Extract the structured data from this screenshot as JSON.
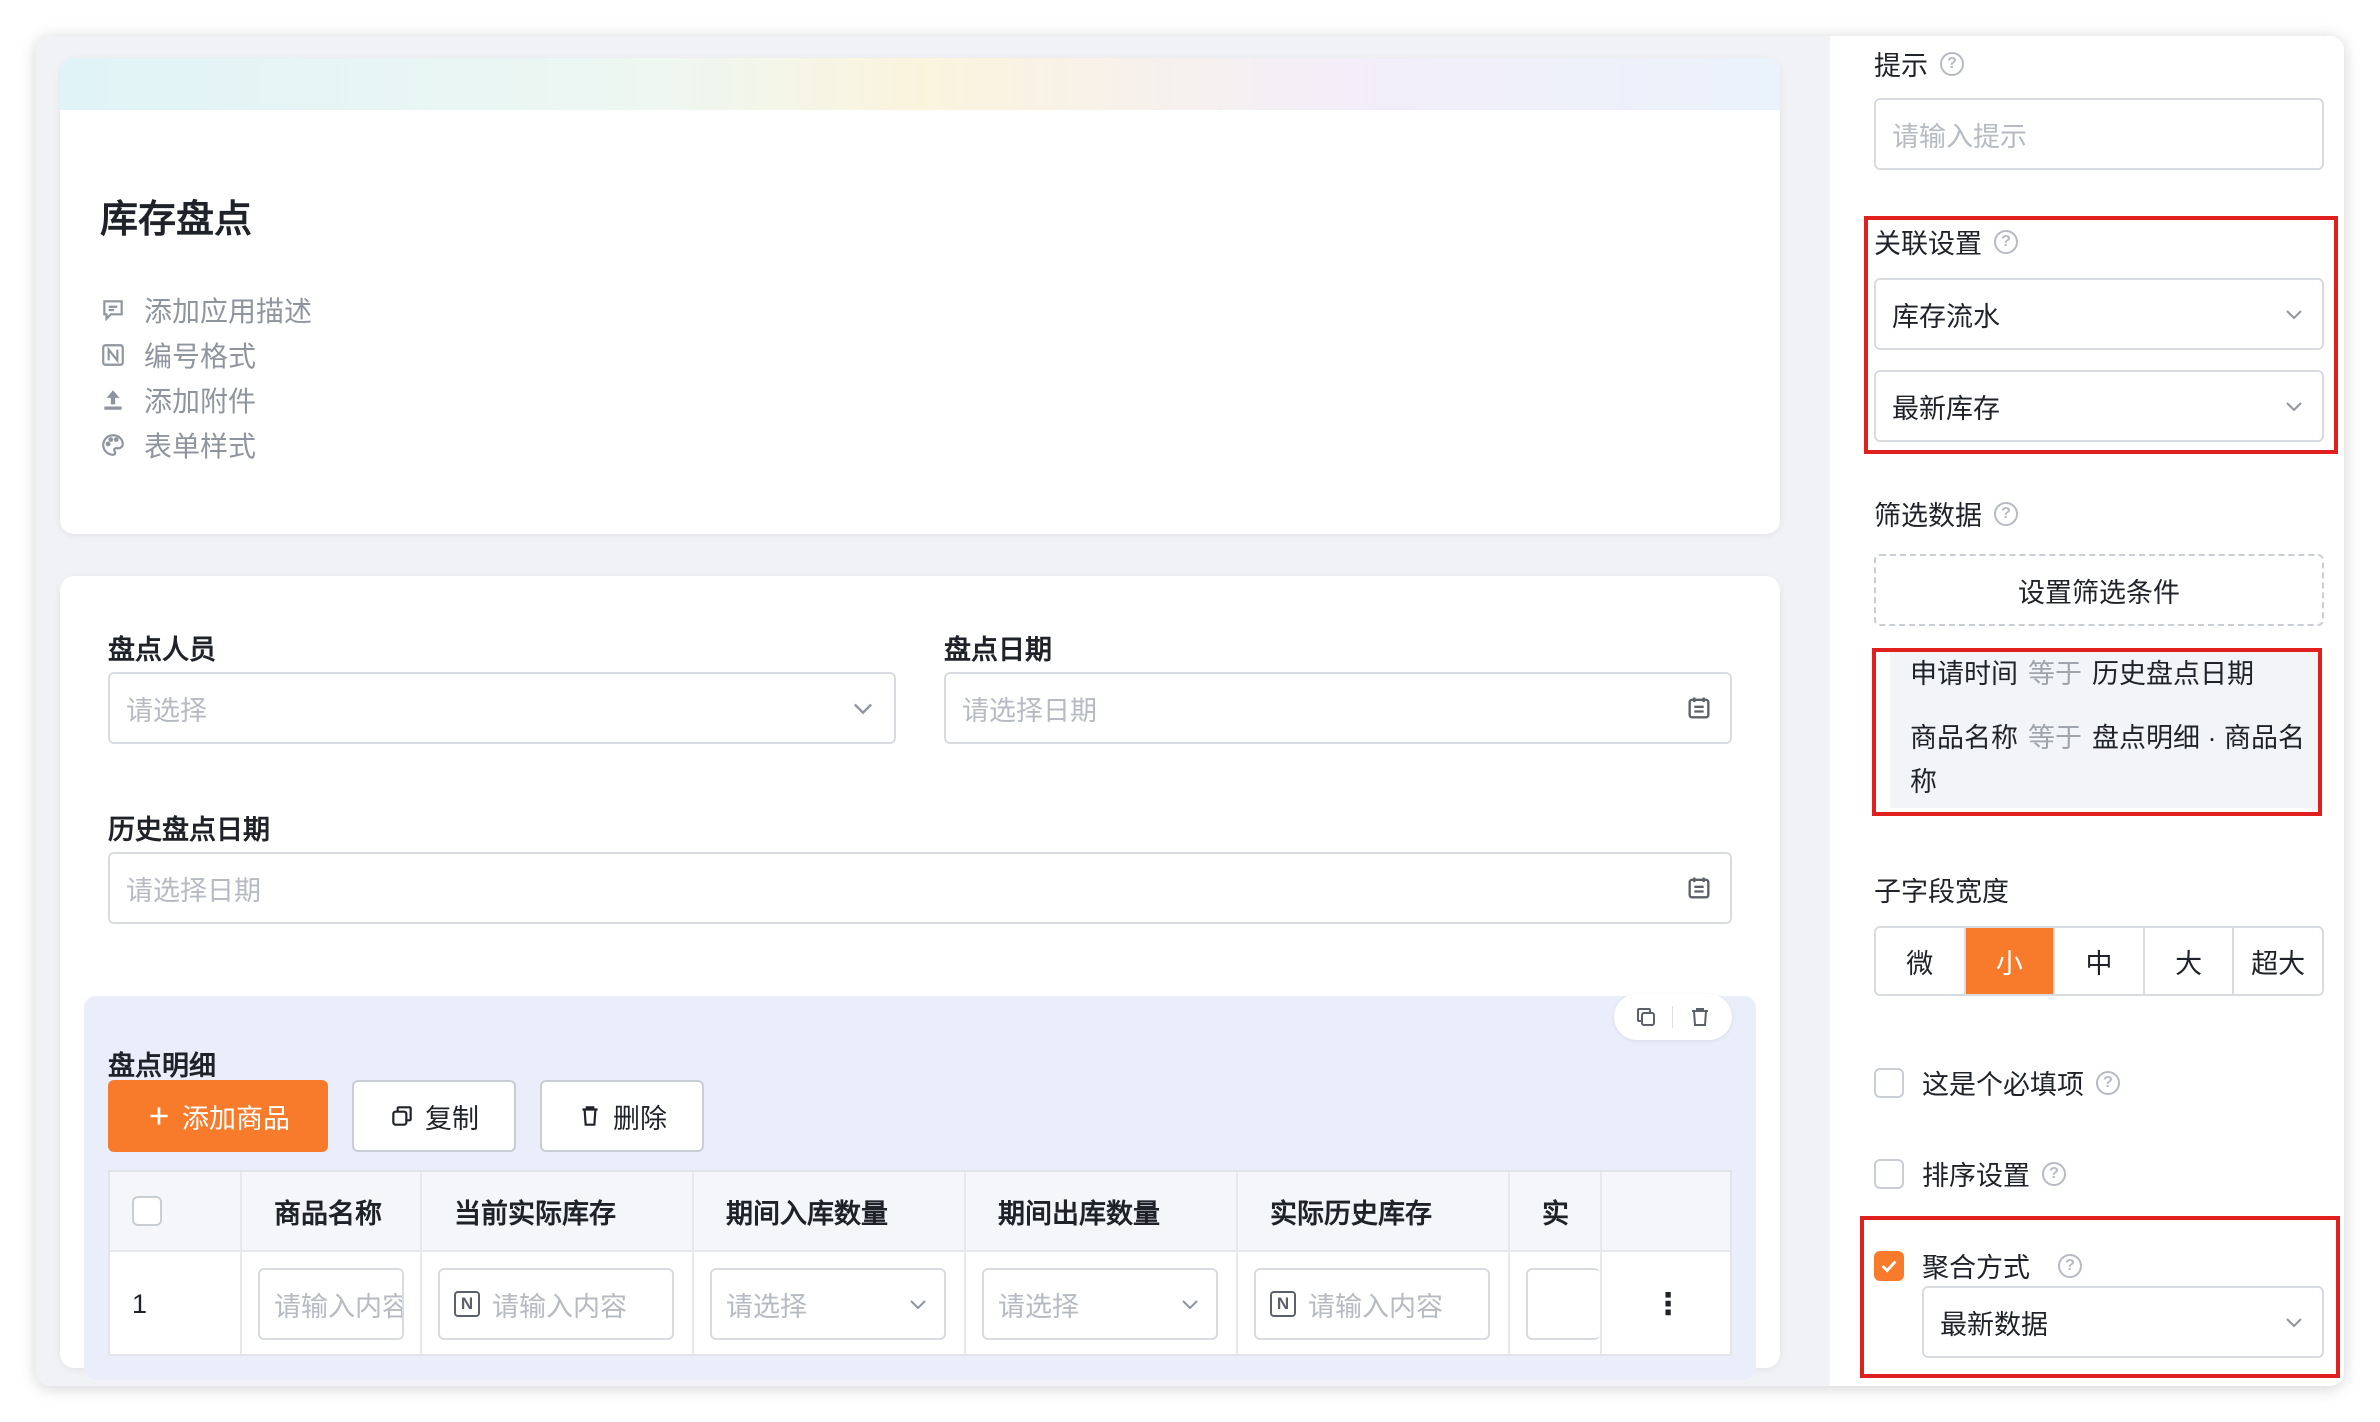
{
  "app": {
    "title": "库存盘点",
    "meta": [
      {
        "icon": "comment-icon",
        "label": "添加应用描述"
      },
      {
        "icon": "number-format-icon",
        "label": "编号格式"
      },
      {
        "icon": "upload-icon",
        "label": "添加附件"
      },
      {
        "icon": "palette-icon",
        "label": "表单样式"
      }
    ]
  },
  "form": {
    "counter_label": "盘点人员",
    "counter_placeholder": "请选择",
    "date_label": "盘点日期",
    "date_placeholder": "请选择日期",
    "history_label": "历史盘点日期",
    "history_placeholder": "请选择日期"
  },
  "subtable": {
    "title": "盘点明细",
    "add_button": "添加商品",
    "copy_button": "复制",
    "delete_button": "删除",
    "columns": [
      "商品名称",
      "当前实际库存",
      "期间入库数量",
      "期间出库数量",
      "实际历史库存",
      "实"
    ],
    "row": {
      "index": "1",
      "cells": [
        {
          "type": "text",
          "placeholder": "请输入内容"
        },
        {
          "type": "number",
          "placeholder": "请输入内容"
        },
        {
          "type": "select",
          "placeholder": "请选择"
        },
        {
          "type": "select",
          "placeholder": "请选择"
        },
        {
          "type": "number",
          "placeholder": "请输入内容"
        }
      ]
    },
    "more_glyph": "⋮"
  },
  "panel": {
    "hint_label": "提示",
    "hint_placeholder": "请输入提示",
    "relation_label": "关联设置",
    "relation_form": "库存流水",
    "relation_field": "最新库存",
    "filter_label": "筛选数据",
    "filter_button": "设置筛选条件",
    "filters": [
      {
        "field": "申请时间",
        "op": "等于",
        "value": "历史盘点日期"
      },
      {
        "field": "商品名称",
        "op": "等于",
        "value": "盘点明细 · 商品名称"
      }
    ],
    "width_label": "子字段宽度",
    "width_options": [
      "微",
      "小",
      "中",
      "大",
      "超大"
    ],
    "width_selected": "小",
    "required_label": "这是个必填项",
    "sort_label": "排序设置",
    "aggregate_label": "聚合方式",
    "aggregate_checked": true,
    "aggregate_value": "最新数据",
    "help_glyph": "?"
  },
  "colors": {
    "accent": "#f77b2b",
    "highlight_border": "#e01f1f"
  }
}
